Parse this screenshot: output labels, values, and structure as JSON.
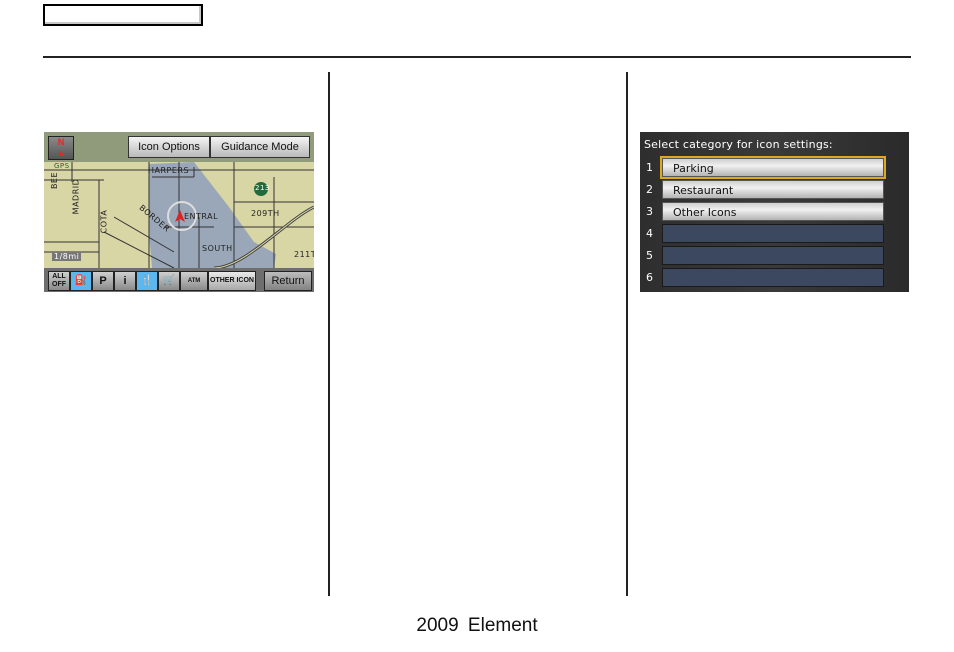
{
  "header": {
    "tab_label": "",
    "rule": true
  },
  "map_screen": {
    "north_indicator": "N",
    "buttons": {
      "icon_options": "Icon Options",
      "guidance_mode": "Guidance Mode",
      "return": "Return"
    },
    "street_labels": {
      "harpers": "HARPERS",
      "central": "ENTRAL",
      "south": "SOUTH",
      "border": "BORDER",
      "madrid": "MADRID",
      "cota": "COTA",
      "bee": "BEE",
      "street_209": "209TH",
      "street_211": "211T",
      "highway": "213",
      "gps": "GPS",
      "scale": "1/8mi"
    },
    "icon_bar": [
      {
        "name": "all-off",
        "label": "ALL OFF",
        "state": "gray"
      },
      {
        "name": "gas-station",
        "label": "⛽",
        "state": "blue"
      },
      {
        "name": "parking",
        "label": "P",
        "state": "gray"
      },
      {
        "name": "info",
        "label": "i",
        "state": "gray"
      },
      {
        "name": "restaurant",
        "label": "🍴",
        "state": "blue"
      },
      {
        "name": "shopping",
        "label": "🛒",
        "state": "gray"
      },
      {
        "name": "atm",
        "label": "ATM",
        "state": "gray"
      },
      {
        "name": "other-icon",
        "label": "OTHER ICON",
        "state": "silver"
      }
    ]
  },
  "category_screen": {
    "title": "Select category for icon settings:",
    "rows": [
      {
        "num": "1",
        "label": "Parking",
        "selected": true
      },
      {
        "num": "2",
        "label": "Restaurant",
        "selected": false
      },
      {
        "num": "3",
        "label": "Other Icons",
        "selected": false
      },
      {
        "num": "4",
        "label": "",
        "selected": false
      },
      {
        "num": "5",
        "label": "",
        "selected": false
      },
      {
        "num": "6",
        "label": "",
        "selected": false
      }
    ],
    "selection_color": "#e0a81a"
  },
  "footer": {
    "text": "2009  Element"
  }
}
